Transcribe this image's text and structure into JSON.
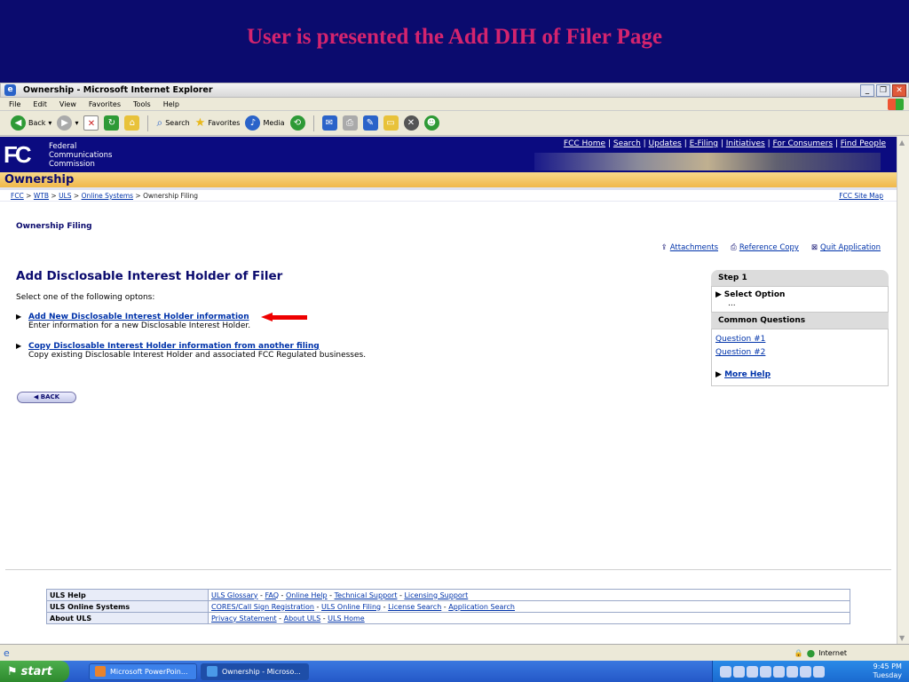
{
  "slide": {
    "title": "User is presented the Add DIH of Filer Page"
  },
  "browser": {
    "window_title": "Ownership - Microsoft Internet Explorer",
    "menu": [
      "File",
      "Edit",
      "View",
      "Favorites",
      "Tools",
      "Help"
    ],
    "toolbar": {
      "back": "Back",
      "search": "Search",
      "favorites": "Favorites",
      "media": "Media"
    },
    "status_zone": "Internet"
  },
  "fcc": {
    "logo": "FC",
    "name_lines": [
      "Federal",
      "Communications",
      "Commission"
    ],
    "top_links": [
      "FCC Home",
      "Search",
      "Updates",
      "E-Filing",
      "Initiatives",
      "For Consumers",
      "Find People"
    ],
    "section_title": "Ownership",
    "breadcrumb": [
      "FCC",
      "WTB",
      "ULS",
      "Online Systems"
    ],
    "breadcrumb_current": "Ownership Filing",
    "site_map": "FCC Site Map"
  },
  "page": {
    "sub_title": "Ownership Filing",
    "actions": {
      "attachments": "Attachments",
      "reference_copy": "Reference Copy",
      "quit": "Quit Application"
    },
    "heading": "Add Disclosable Interest Holder of Filer",
    "instructions": "Select one of the following optons:",
    "options": [
      {
        "link": "Add New Disclosable Interest Holder information",
        "desc": "Enter information for a new Disclosable Interest Holder."
      },
      {
        "link": "Copy Disclosable Interest Holder information from another filing",
        "desc": "Copy existing Disclosable Interest Holder and associated FCC Regulated businesses."
      }
    ],
    "back_button": "BACK"
  },
  "side": {
    "step_title": "Step 1",
    "step_item": "Select Option",
    "step_more": "...",
    "questions_title": "Common Questions",
    "questions": [
      "Question #1",
      "Question #2"
    ],
    "more_help": "More Help"
  },
  "footer": {
    "rows": [
      {
        "label": "ULS Help",
        "links": [
          "ULS Glossary",
          "FAQ",
          "Online Help",
          "Technical Support",
          "Licensing Support"
        ]
      },
      {
        "label": "ULS Online Systems",
        "links": [
          "CORES/Call Sign Registration",
          "ULS Online Filing",
          "License Search",
          "Application Search"
        ]
      },
      {
        "label": "About ULS",
        "links": [
          "Privacy Statement",
          "About ULS",
          "ULS Home"
        ]
      }
    ]
  },
  "taskbar": {
    "start": "start",
    "tasks": [
      "Microsoft PowerPoin...",
      "Ownership - Microso..."
    ],
    "time": "9:45 PM",
    "day": "Tuesday"
  }
}
